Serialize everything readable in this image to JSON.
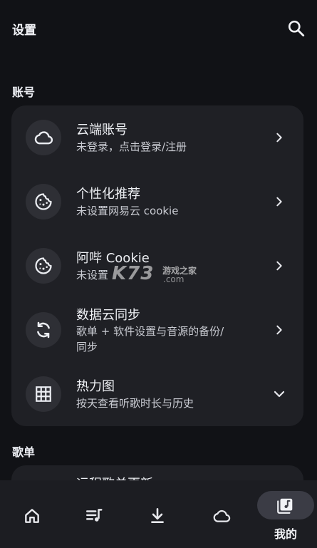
{
  "header": {
    "title": "设置"
  },
  "sections": {
    "account": "账号",
    "playlist": "歌单"
  },
  "account_items": [
    {
      "title": "云端账号",
      "subtitle": "未登录，点击登录/注册",
      "icon": "cloud-icon",
      "action": "chevron-right-icon"
    },
    {
      "title": "个性化推荐",
      "subtitle": "未设置网易云 cookie",
      "icon": "cookie-icon",
      "action": "chevron-right-icon"
    },
    {
      "title": "阿哔 Cookie",
      "subtitle": "未设置",
      "icon": "cookie-icon",
      "action": "chevron-right-icon"
    },
    {
      "title": "数据云同步",
      "subtitle_line1": "歌单 + 软件设置与音源的备份/",
      "subtitle_line2": "同步",
      "icon": "sync-icon",
      "action": "chevron-right-icon"
    },
    {
      "title": "热力图",
      "subtitle": "按天查看听歌时长与历史",
      "icon": "grid-icon",
      "action": "chevron-down-icon"
    }
  ],
  "playlist_items": [
    {
      "title": "远程歌单更新"
    }
  ],
  "watermark": {
    "brand": "K73",
    "name": "游戏之家",
    "domain": ".com"
  },
  "bottom_nav": {
    "items": [
      "home-icon",
      "playlist-icon",
      "download-icon",
      "cloud-icon",
      "my-music-icon"
    ],
    "active_label": "我的"
  },
  "colors": {
    "background": "#111216",
    "card": "#1f2025",
    "icon_circle": "#2e2f35",
    "active_pill": "#3b3c45"
  }
}
